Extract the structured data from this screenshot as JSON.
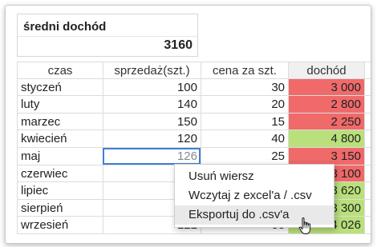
{
  "summary": {
    "title": "średni dochód",
    "value": "3160"
  },
  "table": {
    "headers": [
      "czas",
      "sprzedaż(szt.)",
      "cena za szt.",
      "dochód"
    ],
    "rows": [
      {
        "month": "styczeń",
        "sales": "100",
        "price": "30",
        "income": "3 000",
        "status": "low"
      },
      {
        "month": "luty",
        "sales": "140",
        "price": "20",
        "income": "2 800",
        "status": "low"
      },
      {
        "month": "marzec",
        "sales": "150",
        "price": "15",
        "income": "2 250",
        "status": "low"
      },
      {
        "month": "kwiecień",
        "sales": "120",
        "price": "40",
        "income": "4 800",
        "status": "high"
      },
      {
        "month": "maj",
        "sales": "126",
        "price": "25",
        "income": "3 150",
        "status": "low"
      },
      {
        "month": "czerwiec",
        "sales": "",
        "price": "",
        "income": "3 100",
        "status": "low"
      },
      {
        "month": "lipiec",
        "sales": "",
        "price": "",
        "income": "3 620",
        "status": "high"
      },
      {
        "month": "sierpień",
        "sales": "",
        "price": "",
        "income": "3 300",
        "status": "high"
      },
      {
        "month": "wrzesień",
        "sales": "122",
        "price": "33",
        "income": "4 026",
        "status": "high"
      }
    ]
  },
  "context_menu": {
    "items": [
      {
        "label": "Usuń wiersz"
      },
      {
        "label": "Wczytaj z excel'a / .csv"
      },
      {
        "label": "Eksportuj do .csv'a"
      }
    ],
    "hovered_index": 2
  },
  "colors": {
    "low": "#f06a6a",
    "high": "#b9e07a",
    "selection": "#3f7fd8"
  },
  "icons": {
    "cursor": "hand-pointer-icon"
  }
}
